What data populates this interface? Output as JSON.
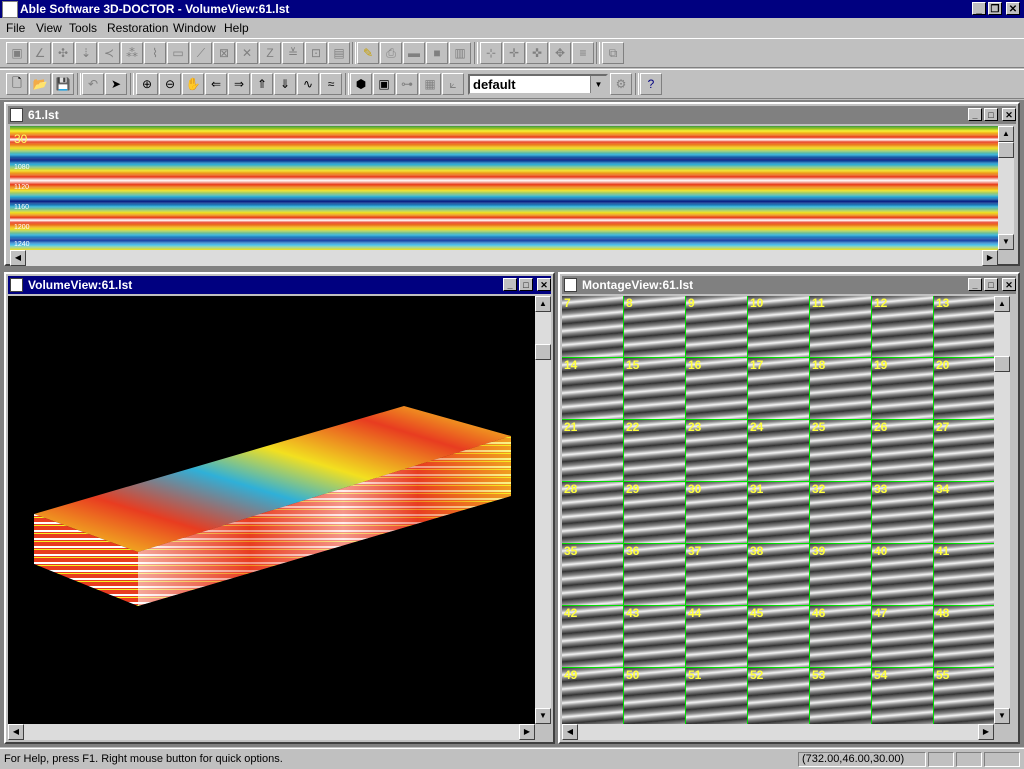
{
  "app": {
    "title": "Able Software 3D-DOCTOR - VolumeView:61.lst"
  },
  "menu": [
    "File",
    "View",
    "Tools",
    "Restoration",
    "Window",
    "Help"
  ],
  "toolbar2": {
    "combo_value": "default"
  },
  "windows": {
    "top": {
      "title": "61.lst",
      "depth_label": "30",
      "ticks": [
        "1080",
        "1120",
        "1160",
        "1200",
        "1240"
      ]
    },
    "volume": {
      "title": "VolumeView:61.lst"
    },
    "montage": {
      "title": "MontageView:61.lst",
      "slices": [
        "7",
        "8",
        "9",
        "10",
        "11",
        "12",
        "13",
        "14",
        "15",
        "16",
        "17",
        "18",
        "19",
        "20",
        "21",
        "22",
        "23",
        "24",
        "25",
        "26",
        "27",
        "28",
        "29",
        "30",
        "31",
        "32",
        "33",
        "34",
        "35",
        "36",
        "37",
        "38",
        "39",
        "40",
        "41",
        "42",
        "43",
        "44",
        "45",
        "46",
        "47",
        "48",
        "49",
        "50",
        "51",
        "52",
        "53",
        "54",
        "55"
      ]
    }
  },
  "status": {
    "help": "For Help, press F1. Right mouse button for quick options.",
    "coords": "(732.00,46.00,30.00)"
  },
  "colors": {
    "title_active": "#000080",
    "title_inactive": "#808080",
    "grid_line": "#00e000",
    "slice_number": "#ffff40"
  }
}
